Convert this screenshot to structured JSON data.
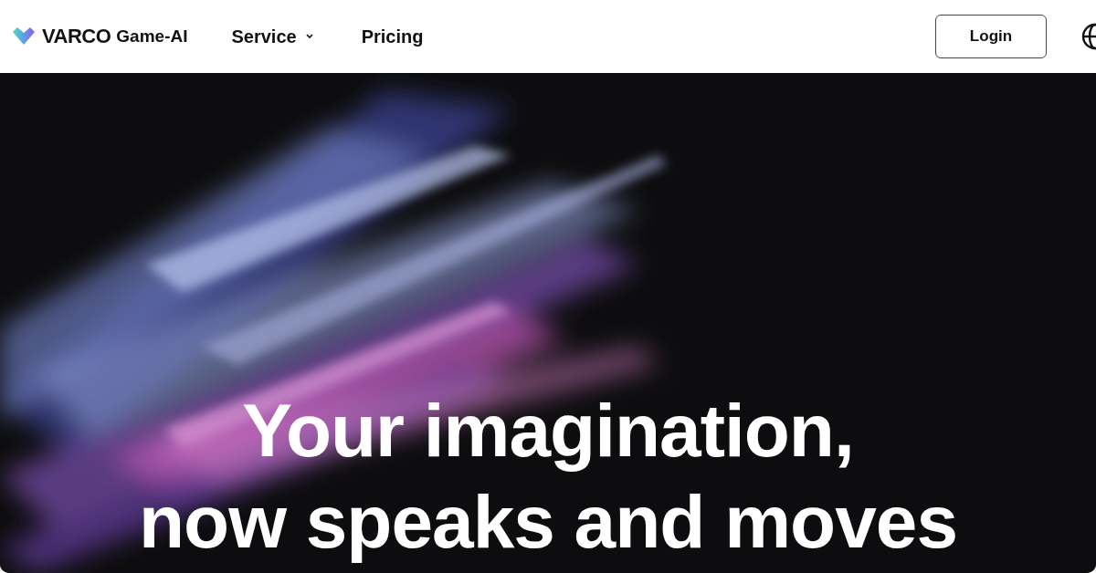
{
  "header": {
    "brand": {
      "name": "VARCO",
      "product": "Game-AI"
    },
    "nav": [
      {
        "label": "Service",
        "has_dropdown": true
      },
      {
        "label": "Pricing",
        "has_dropdown": false
      }
    ],
    "login_button": "Login"
  },
  "hero": {
    "headline_lines": [
      "Your imagination,",
      "now speaks and moves"
    ]
  }
}
